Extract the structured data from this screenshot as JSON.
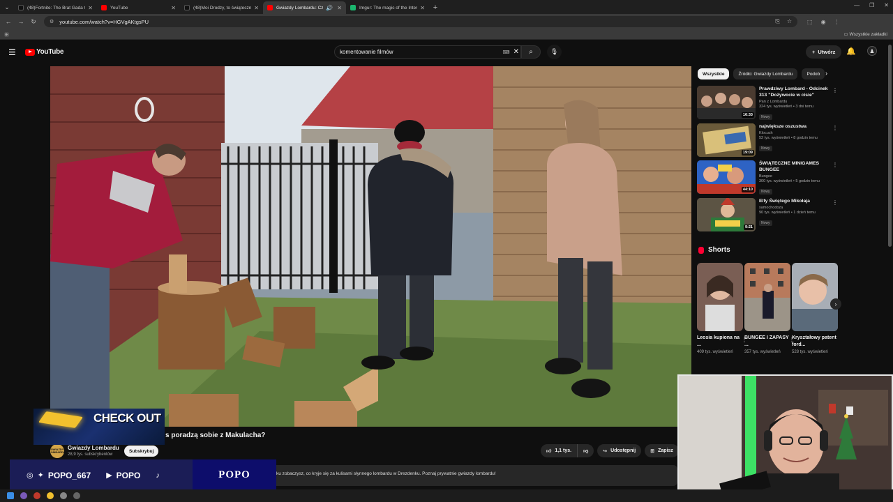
{
  "browser": {
    "tabs": [
      {
        "title": "(48)Fortnite: The Brat Gada Ga...",
        "fav_color": "#111111",
        "active": false
      },
      {
        "title": "YouTube",
        "fav_color": "#ff0000",
        "active": false
      },
      {
        "title": "(48)Moi Drodzy, to świąteczny...",
        "fav_color": "#111111",
        "active": false
      },
      {
        "title": "Gwiazdy Lombardu: Czy ty...",
        "fav_color": "#ff0000",
        "active": true
      },
      {
        "title": "Imgur: The magic of the Intern...",
        "fav_color": "#1bb76e",
        "active": false
      }
    ],
    "url": "youtube.com/watch?v=HGVgAKtgsPU",
    "all_bookmarks": "Wszystkie zakładki"
  },
  "header": {
    "logo_text": "YouTube",
    "search_value": "komentowanie filmów",
    "create_label": "Utwórz"
  },
  "video": {
    "title_visible": "s poradzą sobie z Makulacha?",
    "channel_name": "Gwiazdy Lombardu",
    "channel_subs": "28,9 tys. subskrybentów",
    "channel_avatar_text": "GWIAZDY LOMBARDU",
    "subscribe_label": "Subskrybuj",
    "like_count": "1,1 tys.",
    "share_label": "Udostępnij",
    "save_label": "Zapisz",
    "description": "ku zobaczysz, co kryje się za kulisami słynnego lombardu w Drezdenku. Poznaj prywatnie gwiazdy lombardu!"
  },
  "chips": [
    "Wszystkie",
    "Źródło: Gwiazdy Lombardu",
    "Podob"
  ],
  "recommendations": [
    {
      "title": "Prawdziwy Lombard - Odcinek 313 \"Dożywocie w cisie\"",
      "channel": "Pan z Lombardu",
      "meta": "324 tys. wyświetleń • 3 dni temu",
      "badge": "Nowy",
      "duration": "16:33",
      "thumb_color": "#5b4a3c"
    },
    {
      "title": "największe oszustwa",
      "channel": "Klocuch",
      "meta": "52 tys. wyświetleń • 8 godzin temu",
      "badge": "Nowy",
      "duration": "19:09",
      "thumb_color": "#b89a52"
    },
    {
      "title": "ŚWIĄTECZNE MINIGAMES BUNGEE",
      "channel": "Bungee",
      "meta": "300 tys. wyświetleń • 5 godzin temu",
      "badge": "Nowy",
      "duration": "44:10",
      "thumb_color": "#2e63c4"
    },
    {
      "title": "Elfy Świętego Mikołaja",
      "channel": "samochodoza",
      "meta": "90 tys. wyświetleń • 1 dzień temu",
      "badge": "Nowy",
      "duration": "9:21",
      "thumb_color": "#6d5d46"
    }
  ],
  "shorts": {
    "heading": "Shorts",
    "items": [
      {
        "title": "Leosia kupiona na ...",
        "views": "409 tys. wyświetleń",
        "thumb_color": "#7a5e54"
      },
      {
        "title": "BUNGEE I ZAPASY ...",
        "views": "357 tys. wyświetleń",
        "thumb_color": "#8a8070"
      },
      {
        "title": "Kryształowy patent ford...",
        "views": "528 tys. wyświetleń",
        "thumb_color": "#9aa0a8"
      }
    ]
  },
  "overlay": {
    "checkout_text": "CHECK OUT",
    "handle": "POPO_667",
    "yt_handle": "POPO",
    "brand": "POPO"
  }
}
